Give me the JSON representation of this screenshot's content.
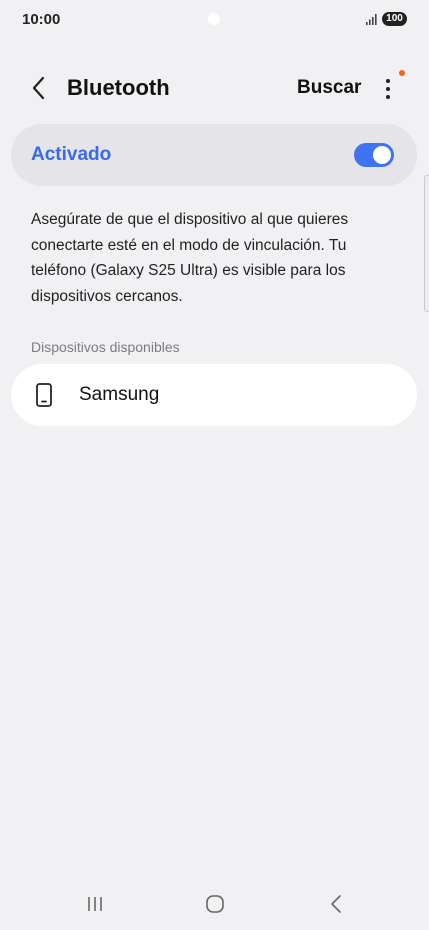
{
  "status_bar": {
    "time": "10:00",
    "battery": "100",
    "icons": [
      "signal-icon",
      "battery-icon"
    ]
  },
  "header": {
    "title": "Bluetooth",
    "search_label": "Buscar",
    "icons": [
      "back-icon",
      "more-options-icon"
    ],
    "notification_dot_color": "#f0641e"
  },
  "bluetooth_toggle": {
    "label": "Activado",
    "state": "on",
    "accent_color": "#3f73ef"
  },
  "description": "Asegúrate de que el dispositivo al que quieres conectarte esté en el modo de vinculación. Tu teléfono (Galaxy S25 Ultra) es visible para los dispositivos cercanos.",
  "available_devices": {
    "header": "Dispositivos disponibles",
    "items": [
      {
        "name": "Samsung",
        "icon": "phone-icon"
      }
    ]
  },
  "nav_bar": {
    "icons": [
      "recent-apps-icon",
      "home-icon",
      "nav-back-icon"
    ]
  }
}
